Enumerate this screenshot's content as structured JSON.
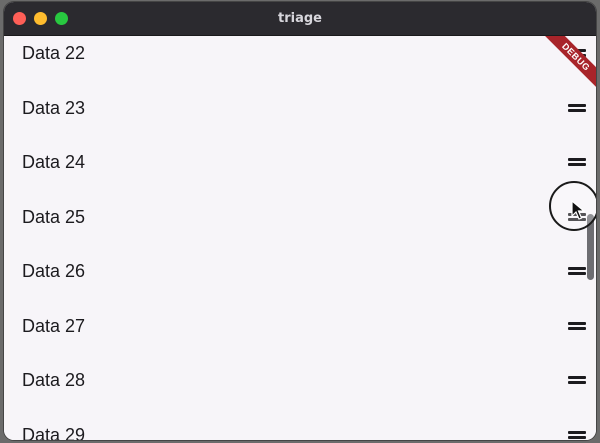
{
  "window": {
    "title": "triage"
  },
  "debug_banner": "DEBUG",
  "rows": [
    {
      "label": "Data 22"
    },
    {
      "label": "Data 23"
    },
    {
      "label": "Data 24"
    },
    {
      "label": "Data 25"
    },
    {
      "label": "Data 26"
    },
    {
      "label": "Data 27"
    },
    {
      "label": "Data 28"
    },
    {
      "label": "Data 29"
    }
  ],
  "icons": {
    "row_handle": "drag-handle-icon",
    "cursor": "cursor-arrow-icon"
  },
  "colors": {
    "titlebar": "#2b2a2f",
    "background": "#f7f5f9",
    "text": "#1c1b1f",
    "debug": "#a8242a",
    "close": "#fe5f57",
    "minimize": "#febc2e",
    "zoom": "#28c840"
  }
}
